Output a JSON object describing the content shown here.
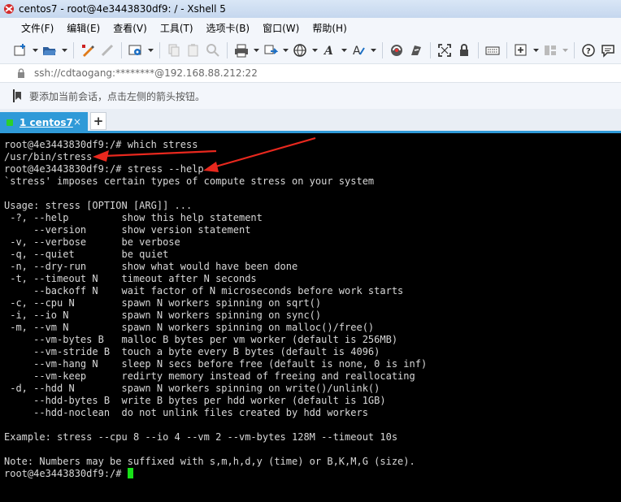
{
  "window": {
    "title": "centos7 - root@4e3443830df9: / - Xshell 5"
  },
  "menu": {
    "items": [
      "文件(F)",
      "编辑(E)",
      "查看(V)",
      "工具(T)",
      "选项卡(B)",
      "窗口(W)",
      "帮助(H)"
    ]
  },
  "address": {
    "text": "ssh://cdtaogang:********@192.168.88.212:22"
  },
  "tip": {
    "text": "要添加当前会话，点击左侧的箭头按钮。"
  },
  "tabs": {
    "active_index": "1",
    "active_label": "centos7",
    "close": "×",
    "new": "+"
  },
  "terminal": {
    "lines": [
      "root@4e3443830df9:/# which stress",
      "/usr/bin/stress",
      "root@4e3443830df9:/# stress --help",
      "`stress' imposes certain types of compute stress on your system",
      "",
      "Usage: stress [OPTION [ARG]] ...",
      " -?, --help         show this help statement",
      "     --version      show version statement",
      " -v, --verbose      be verbose",
      " -q, --quiet        be quiet",
      " -n, --dry-run      show what would have been done",
      " -t, --timeout N    timeout after N seconds",
      "     --backoff N    wait factor of N microseconds before work starts",
      " -c, --cpu N        spawn N workers spinning on sqrt()",
      " -i, --io N         spawn N workers spinning on sync()",
      " -m, --vm N         spawn N workers spinning on malloc()/free()",
      "     --vm-bytes B   malloc B bytes per vm worker (default is 256MB)",
      "     --vm-stride B  touch a byte every B bytes (default is 4096)",
      "     --vm-hang N    sleep N secs before free (default is none, 0 is inf)",
      "     --vm-keep      redirty memory instead of freeing and reallocating",
      " -d, --hdd N        spawn N workers spinning on write()/unlink()",
      "     --hdd-bytes B  write B bytes per hdd worker (default is 1GB)",
      "     --hdd-noclean  do not unlink files created by hdd workers",
      "",
      "Example: stress --cpu 8 --io 4 --vm 2 --vm-bytes 128M --timeout 10s",
      "",
      "Note: Numbers may be suffixed with s,m,h,d,y (time) or B,K,M,G (size)."
    ],
    "prompt": "root@4e3443830df9:/# ",
    "cursor_color": "#18e018"
  },
  "annotations": {
    "arrow_color": "#e8281e"
  },
  "toolbar": {
    "icons": [
      "new-session-icon",
      "open-folder-icon",
      "edit-properties-icon",
      "disconnect-icon",
      "reconnect-icon",
      "settings-icon",
      "copy-icon",
      "paste-icon",
      "find-icon",
      "print-icon",
      "transfer-icon",
      "globe-icon",
      "font-icon",
      "font-color-icon",
      "xftp-icon",
      "xmanager-icon",
      "fullscreen-icon",
      "lock-icon",
      "keyboard-icon",
      "add-icon",
      "layout-icon",
      "help-icon",
      "chat-icon"
    ]
  }
}
